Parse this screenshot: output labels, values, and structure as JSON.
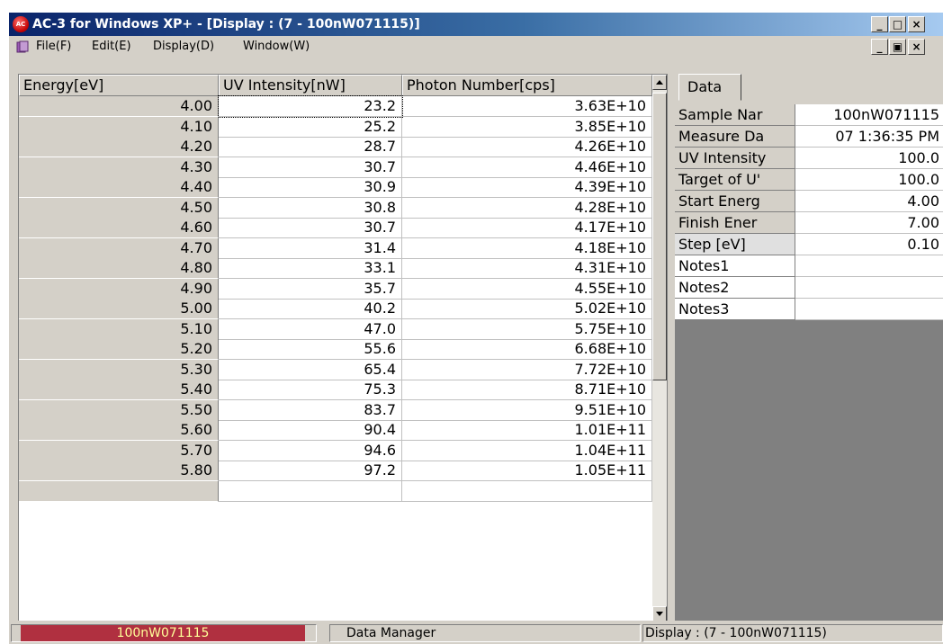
{
  "window": {
    "title": "AC-3 for Windows XP+ - [Display : (7 - 100nW071115)]",
    "controls": [
      "_",
      "□",
      "×"
    ],
    "child_controls": [
      "_",
      "▣",
      "×"
    ]
  },
  "menu": [
    "File(F)",
    "Edit(E)",
    "Display(D)",
    "Window(W)"
  ],
  "table": {
    "headers": [
      "Energy[eV]",
      "UV Intensity[nW]",
      "Photon Number[cps]"
    ],
    "rows": [
      [
        "4.00",
        "23.2",
        "3.63E+10"
      ],
      [
        "4.10",
        "25.2",
        "3.85E+10"
      ],
      [
        "4.20",
        "28.7",
        "4.26E+10"
      ],
      [
        "4.30",
        "30.7",
        "4.46E+10"
      ],
      [
        "4.40",
        "30.9",
        "4.39E+10"
      ],
      [
        "4.50",
        "30.8",
        "4.28E+10"
      ],
      [
        "4.60",
        "30.7",
        "4.17E+10"
      ],
      [
        "4.70",
        "31.4",
        "4.18E+10"
      ],
      [
        "4.80",
        "33.1",
        "4.31E+10"
      ],
      [
        "4.90",
        "35.7",
        "4.55E+10"
      ],
      [
        "5.00",
        "40.2",
        "5.02E+10"
      ],
      [
        "5.10",
        "47.0",
        "5.75E+10"
      ],
      [
        "5.20",
        "55.6",
        "6.68E+10"
      ],
      [
        "5.30",
        "65.4",
        "7.72E+10"
      ],
      [
        "5.40",
        "75.3",
        "8.71E+10"
      ],
      [
        "5.50",
        "83.7",
        "9.51E+10"
      ],
      [
        "5.60",
        "90.4",
        "1.01E+11"
      ],
      [
        "5.70",
        "94.6",
        "1.04E+11"
      ],
      [
        "5.80",
        "97.2",
        "1.05E+11"
      ]
    ]
  },
  "panel": {
    "tab": "Data",
    "properties": [
      {
        "key": "Sample Nar",
        "value": "100nW071115"
      },
      {
        "key": "Measure Da",
        "value": "07 1:36:35 PM"
      },
      {
        "key": "UV Intensity",
        "value": "100.0"
      },
      {
        "key": "Target of U'",
        "value": "100.0"
      },
      {
        "key": "Start Energ",
        "value": "4.00"
      },
      {
        "key": "Finish Ener",
        "value": "7.00"
      },
      {
        "key": "Step [eV]",
        "value": "0.10"
      },
      {
        "key": "Notes1",
        "value": ""
      },
      {
        "key": "Notes2",
        "value": ""
      },
      {
        "key": "Notes3",
        "value": ""
      }
    ]
  },
  "status": {
    "sample": "100nW071115",
    "manager": "Data Manager",
    "display": "Display : (7 - 100nW071115)"
  }
}
